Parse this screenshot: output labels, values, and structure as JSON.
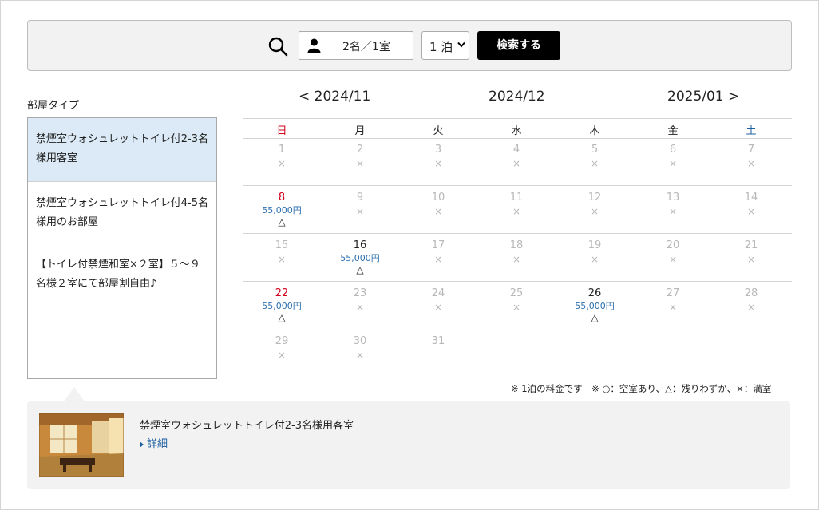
{
  "search": {
    "guests_label": "2名／1室",
    "nights_value": "1 泊",
    "button_label": "検索する"
  },
  "room_types": {
    "heading": "部屋タイプ",
    "items": [
      {
        "label": "禁煙室ウォシュレットトイレ付2-3名様用客室",
        "selected": true
      },
      {
        "label": "禁煙室ウォシュレットトイレ付4-5名様用のお部屋",
        "selected": false
      },
      {
        "label": "【トイレ付禁煙和室×２室】５～９名様２室にて部屋割自由♪",
        "selected": false
      }
    ]
  },
  "calendar": {
    "prev_label": "< 2024/11",
    "current_label": "2024/12",
    "next_label": "2025/01 >",
    "weekdays": [
      "日",
      "月",
      "火",
      "水",
      "木",
      "金",
      "土"
    ],
    "weekday_colors": [
      "#d3001c",
      "#222222",
      "#222222",
      "#222222",
      "#222222",
      "#222222",
      "#1e5fa0"
    ],
    "weeks": [
      [
        {
          "day": "1",
          "mark": "×"
        },
        {
          "day": "2",
          "mark": "×"
        },
        {
          "day": "3",
          "mark": "×"
        },
        {
          "day": "4",
          "mark": "×"
        },
        {
          "day": "5",
          "mark": "×"
        },
        {
          "day": "6",
          "mark": "×"
        },
        {
          "day": "7",
          "mark": "×"
        }
      ],
      [
        {
          "day": "8",
          "price": "55,000円",
          "mark": "△"
        },
        {
          "day": "9",
          "mark": "×"
        },
        {
          "day": "10",
          "mark": "×"
        },
        {
          "day": "11",
          "mark": "×"
        },
        {
          "day": "12",
          "mark": "×"
        },
        {
          "day": "13",
          "mark": "×"
        },
        {
          "day": "14",
          "mark": "×"
        }
      ],
      [
        {
          "day": "15",
          "mark": "×"
        },
        {
          "day": "16",
          "price": "55,000円",
          "mark": "△"
        },
        {
          "day": "17",
          "mark": "×"
        },
        {
          "day": "18",
          "mark": "×"
        },
        {
          "day": "19",
          "mark": "×"
        },
        {
          "day": "20",
          "mark": "×"
        },
        {
          "day": "21",
          "mark": "×"
        }
      ],
      [
        {
          "day": "22",
          "price": "55,000円",
          "mark": "△"
        },
        {
          "day": "23",
          "mark": "×"
        },
        {
          "day": "24",
          "mark": "×"
        },
        {
          "day": "25",
          "mark": "×"
        },
        {
          "day": "26",
          "price": "55,000円",
          "mark": "△"
        },
        {
          "day": "27",
          "mark": "×"
        },
        {
          "day": "28",
          "mark": "×"
        }
      ],
      [
        {
          "day": "29",
          "mark": "×"
        },
        {
          "day": "30",
          "mark": "×"
        },
        {
          "day": "31",
          "mark": ""
        },
        null,
        null,
        null,
        null
      ]
    ],
    "note": "※ 1泊の料金です　※ ○：空室あり、△：残りわずか、×：満室"
  },
  "detail": {
    "title": "禁煙室ウォシュレットトイレ付2-3名様用客室",
    "link_label": "詳細"
  },
  "icons": {
    "search": "search-icon",
    "person": "person-icon",
    "select": "chevron-down-icon",
    "detail_arrow": "triangle-right-icon"
  }
}
